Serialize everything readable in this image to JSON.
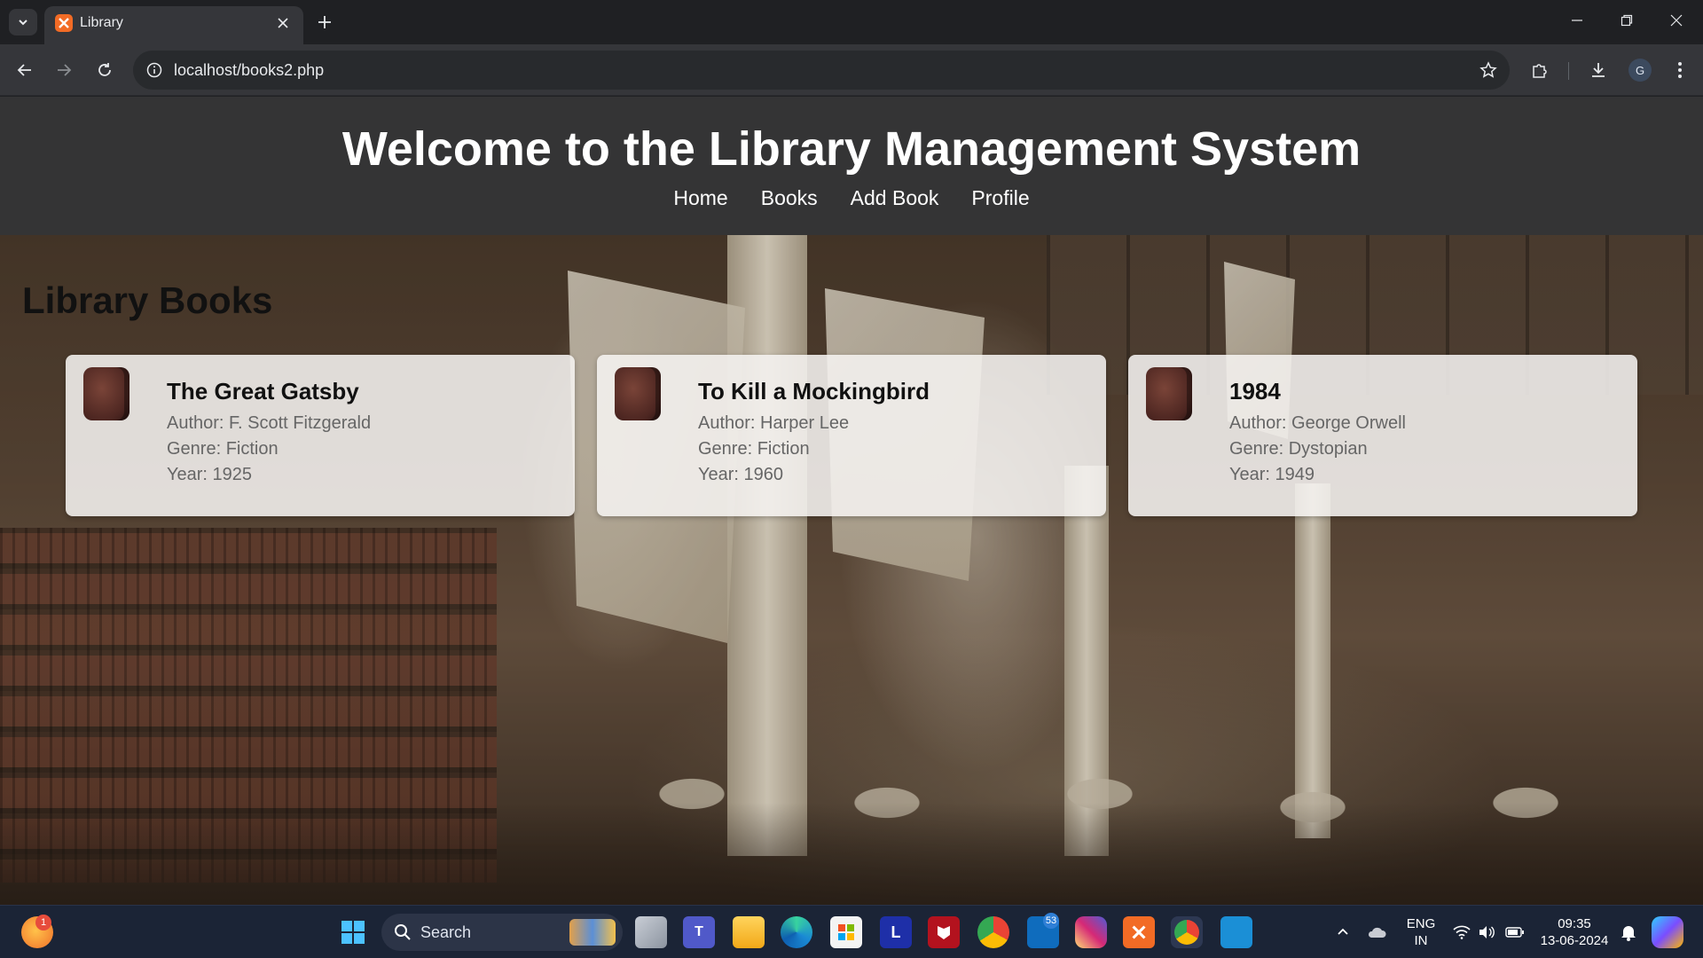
{
  "browser": {
    "tab_title": "Library",
    "url": "localhost/books2.php",
    "profile_initial": "G"
  },
  "site": {
    "title": "Welcome to the Library Management System",
    "nav": [
      "Home",
      "Books",
      "Add Book",
      "Profile"
    ]
  },
  "main": {
    "section_title": "Library Books",
    "books": [
      {
        "title": "The Great Gatsby",
        "author": "Author: F. Scott Fitzgerald",
        "genre": "Genre: Fiction",
        "year": "Year: 1925"
      },
      {
        "title": "To Kill a Mockingbird",
        "author": "Author: Harper Lee",
        "genre": "Genre: Fiction",
        "year": "Year: 1960"
      },
      {
        "title": "1984",
        "author": "Author: George Orwell",
        "genre": "Genre: Dystopian",
        "year": "Year: 1949"
      }
    ]
  },
  "taskbar": {
    "search_label": "Search",
    "weather_badge": "1",
    "outlook_badge": "53",
    "lang_top": "ENG",
    "lang_bottom": "IN",
    "time": "09:35",
    "date": "13-06-2024"
  }
}
